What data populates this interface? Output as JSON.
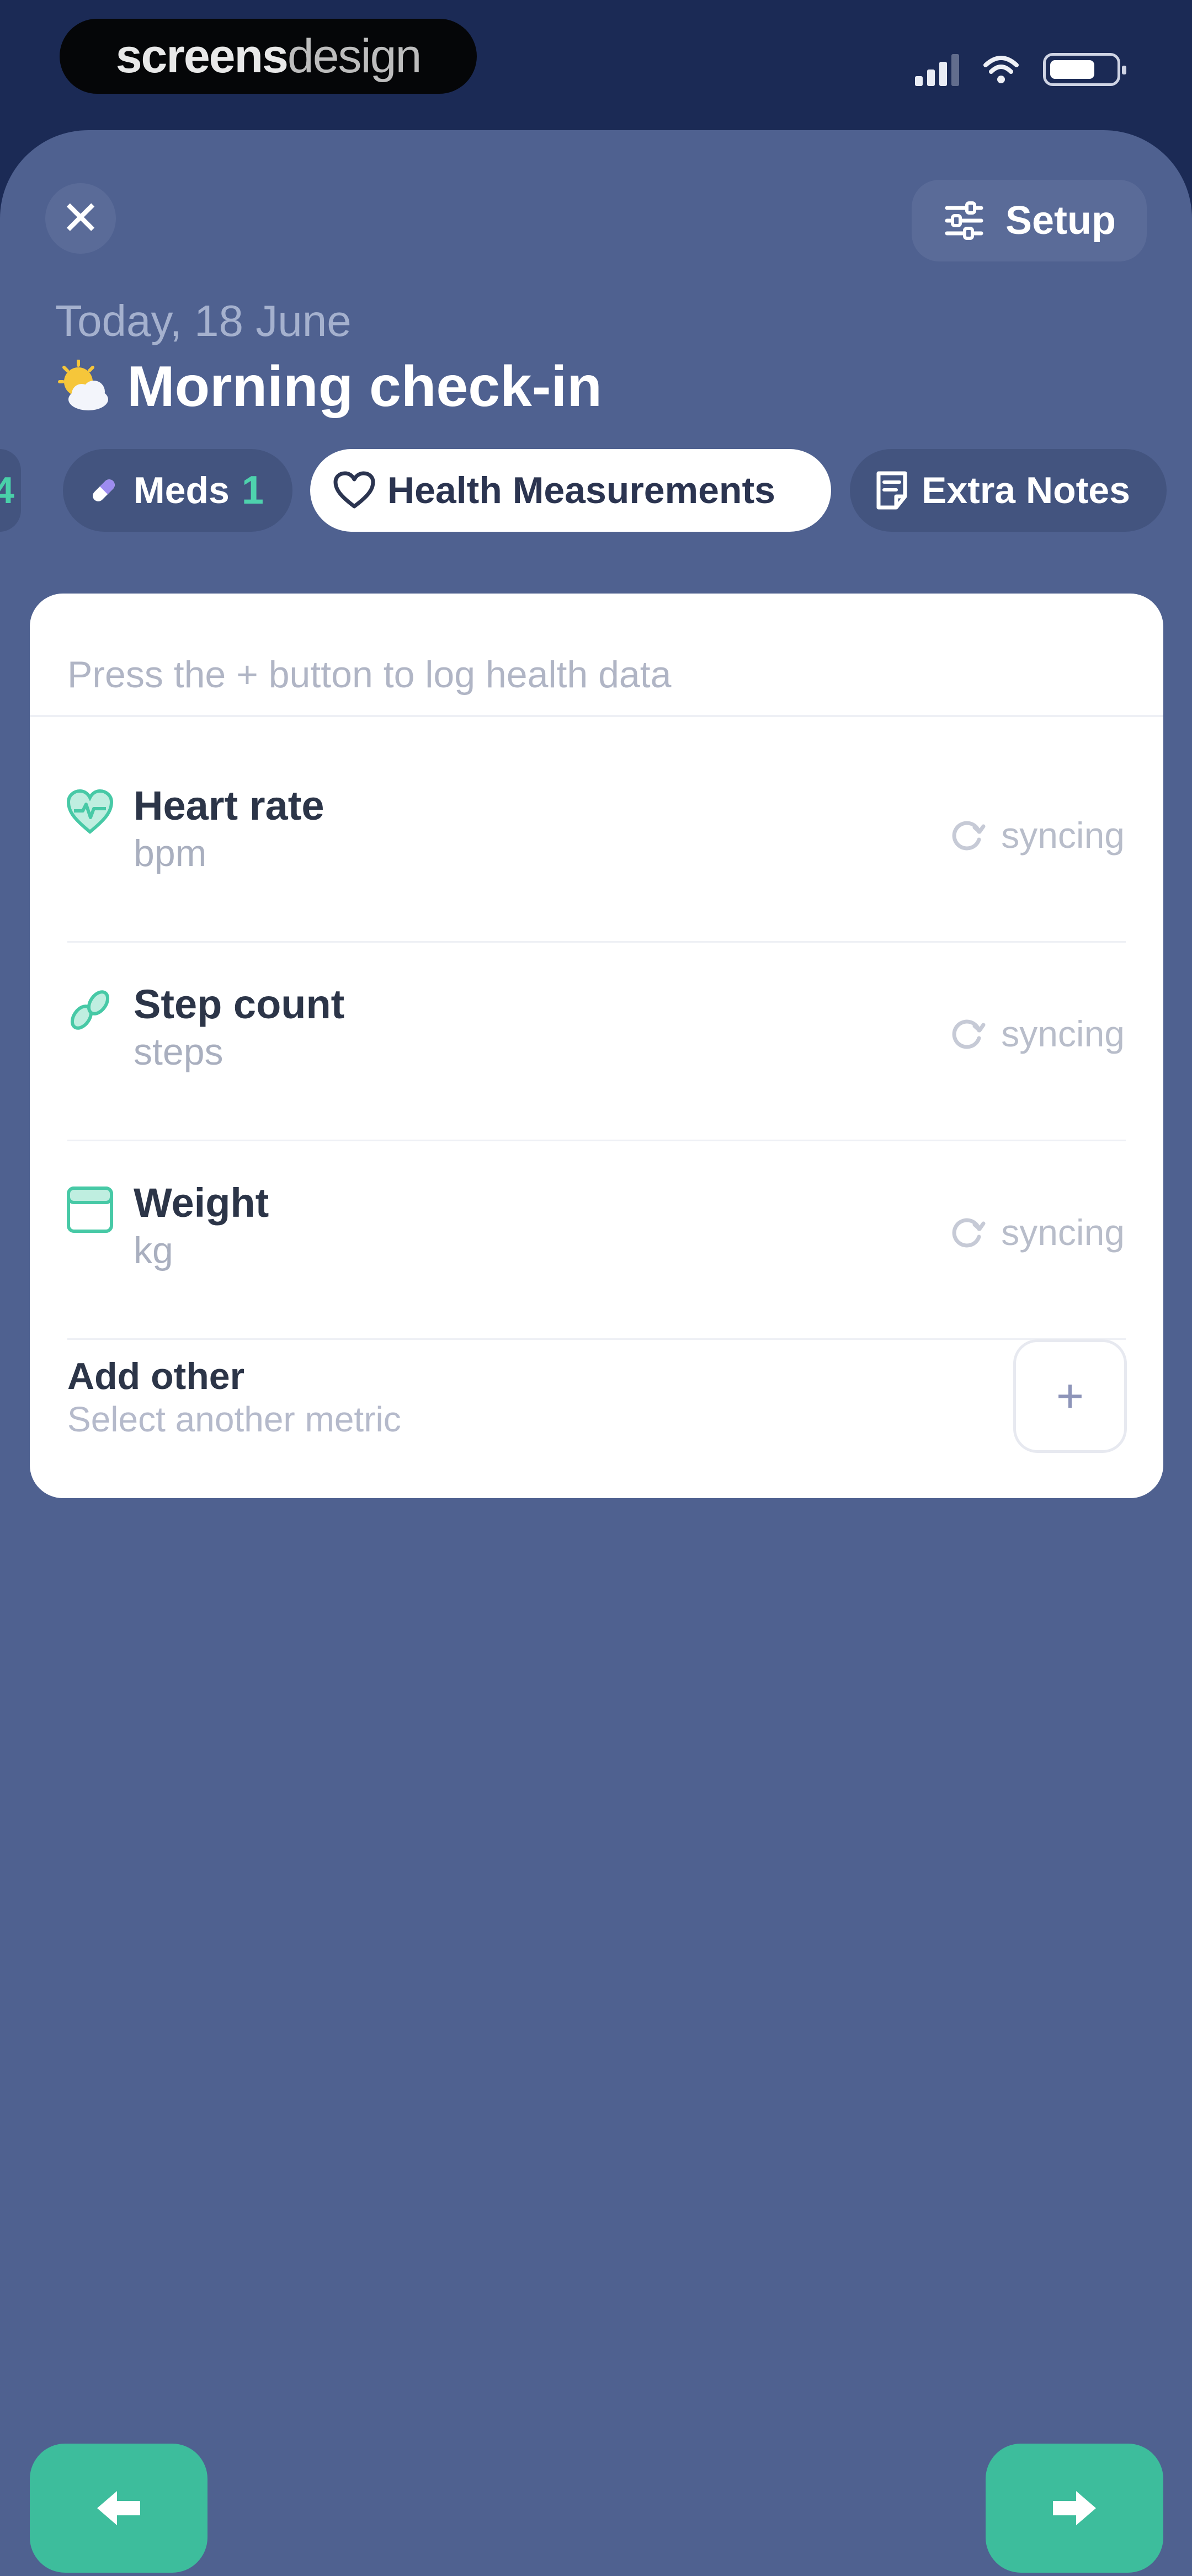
{
  "status_bar": {
    "brand_bold": "screens",
    "brand_light": "design"
  },
  "header": {
    "close_label": "✕",
    "setup_label": "Setup",
    "date": "Today, 18 June",
    "title": "Morning check-in"
  },
  "tabs": [
    {
      "label": "",
      "count": "4"
    },
    {
      "label": "Meds",
      "count": "1"
    },
    {
      "label": "Health Measurements",
      "active": true
    },
    {
      "label": "Extra Notes"
    }
  ],
  "card": {
    "hint": "Press the + button to log health data",
    "metrics": [
      {
        "name": "Heart rate",
        "unit": "bpm",
        "status": "syncing",
        "icon": "heart-icon"
      },
      {
        "name": "Step count",
        "unit": "steps",
        "status": "syncing",
        "icon": "footsteps-icon"
      },
      {
        "name": "Weight",
        "unit": "kg",
        "status": "syncing",
        "icon": "scale-icon"
      }
    ],
    "add_other": {
      "title": "Add other",
      "subtitle": "Select another metric",
      "button": "+"
    }
  },
  "colors": {
    "sheet_bg": "#4f6190",
    "accent": "#3dbd9c",
    "card_bg": "#ffffff"
  }
}
